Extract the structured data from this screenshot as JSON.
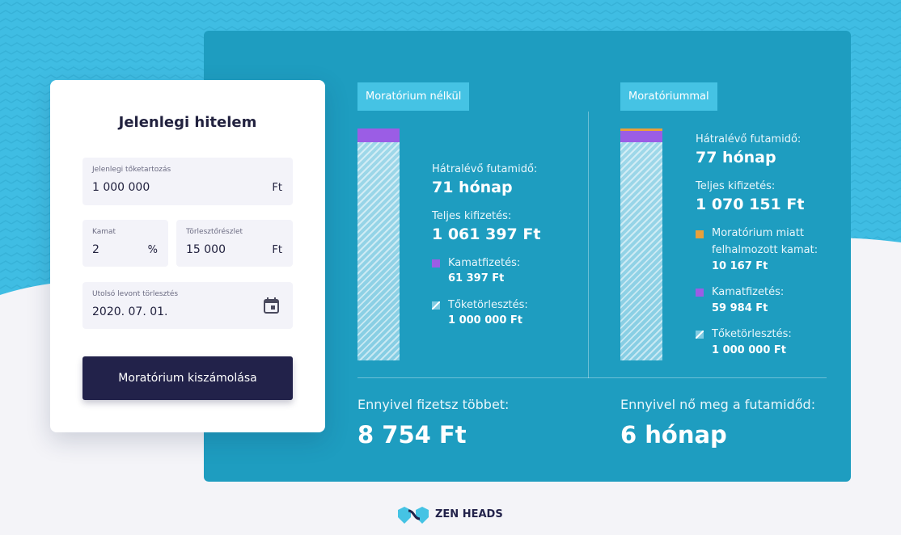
{
  "colors": {
    "panel": "#1e9dc0",
    "tag": "#45c3e4",
    "interest": "#9b5de5",
    "accumulated": "#e8a03b",
    "button": "#22224a",
    "background_wave": "#3fbde3"
  },
  "form": {
    "title": "Jelenlegi hitelem",
    "principal": {
      "label": "Jelenlegi tőketartozás",
      "value": "1 000 000",
      "suffix": "Ft"
    },
    "interest": {
      "label": "Kamat",
      "value": "2",
      "suffix": "%"
    },
    "installment": {
      "label": "Törlesztőrészlet",
      "value": "15 000",
      "suffix": "Ft"
    },
    "last_payment": {
      "label": "Utolsó levont törlesztés",
      "value": "2020. 07. 01.",
      "icon": "calendar-icon"
    },
    "button_label": "Moratórium kiszámolása"
  },
  "without": {
    "tag": "Moratórium nélkül",
    "remaining_label": "Hátralévő futamidő:",
    "remaining_value": "71 hónap",
    "total_label": "Teljes kifizetés:",
    "total_value": "1 061 397 Ft",
    "interest_label": "Kamatfizetés:",
    "interest_value": "61 397 Ft",
    "principal_label": "Tőketörlesztés:",
    "principal_value": "1 000 000 Ft"
  },
  "with": {
    "tag": "Moratóriummal",
    "remaining_label": "Hátralévő futamidő:",
    "remaining_value": "77 hónap",
    "total_label": "Teljes kifizetés:",
    "total_value": "1 070 151 Ft",
    "accumulated_label_1": "Moratórium miatt",
    "accumulated_label_2": "felhalmozott kamat:",
    "accumulated_value": "10 167 Ft",
    "interest_label": "Kamatfizetés:",
    "interest_value": "59 984 Ft",
    "principal_label": "Tőketörlesztés:",
    "principal_value": "1 000 000 Ft"
  },
  "summary": {
    "extra_cost_label": "Ennyivel fizetsz többet:",
    "extra_cost_value": "8 754 Ft",
    "extra_time_label": "Ennyivel nő meg a futamidőd:",
    "extra_time_value": "6 hónap"
  },
  "brand": {
    "name": "ZEN HEADS"
  }
}
